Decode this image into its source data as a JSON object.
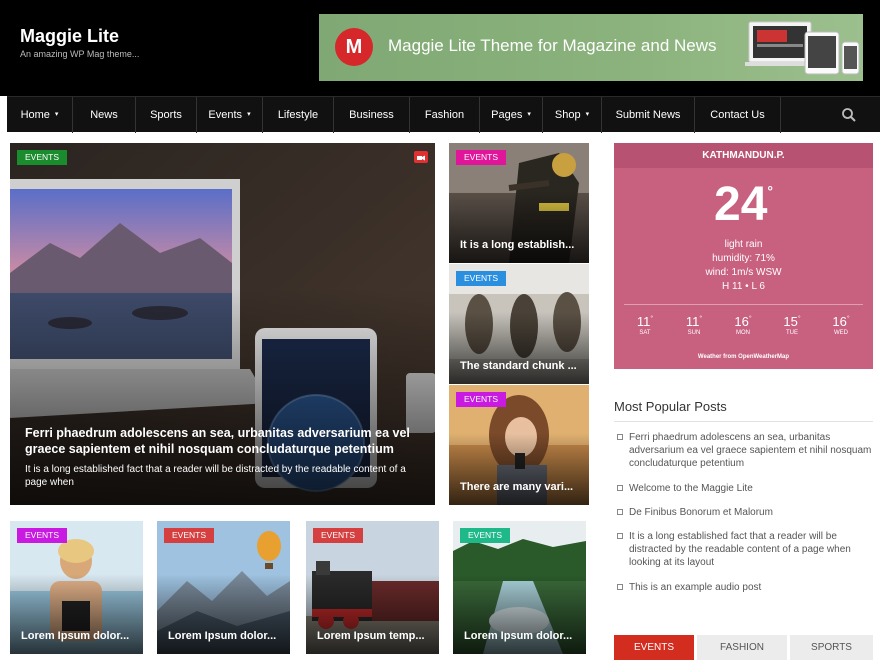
{
  "site": {
    "title": "Maggie Lite",
    "tagline": "An amazing WP Mag theme..."
  },
  "banner": {
    "logo_letter": "M",
    "text": "Maggie Lite Theme for Magazine and News"
  },
  "nav": {
    "items": [
      {
        "label": "Home",
        "chevron": "▾"
      },
      {
        "label": "News"
      },
      {
        "label": "Sports"
      },
      {
        "label": "Events",
        "chevron": "▾"
      },
      {
        "label": "Lifestyle"
      },
      {
        "label": "Business"
      },
      {
        "label": "Fashion"
      },
      {
        "label": "Pages",
        "chevron": "▾"
      },
      {
        "label": "Shop",
        "chevron": "▾"
      },
      {
        "label": "Submit News"
      },
      {
        "label": "Contact Us"
      }
    ],
    "search_icon": "search-icon"
  },
  "hero": {
    "tag": "EVENTS",
    "title": "Ferri phaedrum adolescens an sea, urbanitas adversarium ea vel graece sapientem et nihil nosquam concludaturque petentium",
    "excerpt": "It is a long established fact that a reader will be distracted by the readable content of a page when",
    "video_icon": "video-camera-icon"
  },
  "side_cards": [
    {
      "tag": "EVENTS",
      "title": "It is a long establish..."
    },
    {
      "tag": "EVENTS",
      "title": "The standard chunk ..."
    },
    {
      "tag": "EVENTS",
      "title": "There are many vari..."
    }
  ],
  "bottom_cards": [
    {
      "tag": "EVENTS",
      "title": "Lorem Ipsum dolor..."
    },
    {
      "tag": "EVENTS",
      "title": "Lorem Ipsum dolor..."
    },
    {
      "tag": "EVENTS",
      "title": "Lorem Ipsum temp..."
    },
    {
      "tag": "EVENTS",
      "title": "Lorem Ipsum dolor..."
    }
  ],
  "weather": {
    "city": "KATHMANDUN.P.",
    "temp": "24",
    "deg": "°",
    "condition": "light rain",
    "humidity": "humidity: 71%",
    "wind": "wind: 1m/s WSW",
    "hilo": "H 11 • L 6",
    "forecast": [
      {
        "temp": "11",
        "day": "SAT"
      },
      {
        "temp": "11",
        "day": "SUN"
      },
      {
        "temp": "16",
        "day": "MON"
      },
      {
        "temp": "15",
        "day": "TUE"
      },
      {
        "temp": "16",
        "day": "WED"
      }
    ],
    "credit": "Weather from OpenWeatherMap"
  },
  "popular": {
    "heading": "Most Popular Posts",
    "items": [
      "Ferri phaedrum adolescens an sea, urbanitas adversarium ea vel graece sapientem et nihil nosquam concludaturque petentium",
      "Welcome to the Maggie Lite",
      "De Finibus Bonorum et Malorum",
      "It is a long established fact that a reader will be distracted by the readable content of a page when looking at its layout",
      "This is an example audio post"
    ]
  },
  "tabs": [
    {
      "label": "EVENTS",
      "active": true
    },
    {
      "label": "FASHION",
      "active": false
    },
    {
      "label": "SPORTS",
      "active": false
    }
  ],
  "colors": {
    "accent": "#d22d1f",
    "weather_bg": "#c86080",
    "tag_green": "#1a8c2e",
    "tag_pink": "#e0159a",
    "tag_blue": "#2b8fe0",
    "tag_purple": "#c81ae0",
    "tag_red": "#d63f3f",
    "tag_teal": "#1fb889"
  }
}
